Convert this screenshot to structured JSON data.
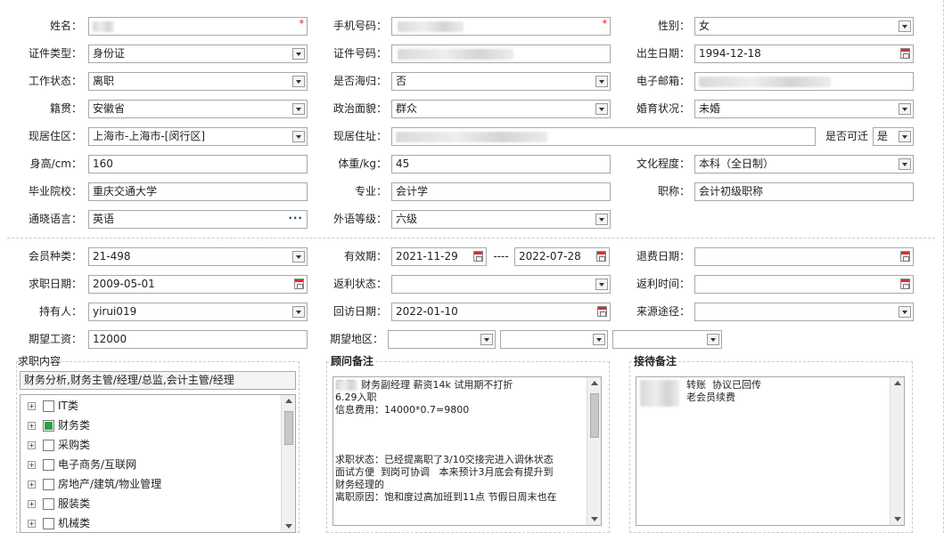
{
  "form": {
    "name_label": "姓名：",
    "name_value": "",
    "phone_label": "手机号码：",
    "phone_value": "",
    "gender_label": "性别：",
    "gender_value": "女",
    "id_type_label": "证件类型：",
    "id_type_value": "身份证",
    "id_no_label": "证件号码：",
    "id_no_value": "",
    "birth_label": "出生日期：",
    "birth_value": "1994-12-18",
    "work_status_label": "工作状态：",
    "work_status_value": "离职",
    "returnee_label": "是否海归：",
    "returnee_value": "否",
    "email_label": "电子邮箱：",
    "email_value": "",
    "native_label": "籍贯：",
    "native_value": "安徽省",
    "political_label": "政治面貌：",
    "political_value": "群众",
    "marital_label": "婚育状况：",
    "marital_value": "未婚",
    "residence_label": "现居住区：",
    "residence_value": "上海市-上海市-[闵行区]",
    "address_label": "现居住址：",
    "address_value": "",
    "relocate_label": "是否可迁",
    "relocate_value": "是",
    "height_label": "身高/cm：",
    "height_value": "160",
    "weight_label": "体重/kg：",
    "weight_value": "45",
    "education_label": "文化程度：",
    "education_value": "本科（全日制）",
    "school_label": "毕业院校：",
    "school_value": "重庆交通大学",
    "major_label": "专业：",
    "major_value": "会计学",
    "title_label": "职称：",
    "title_value": "会计初级职称",
    "language_label": "通晓语言：",
    "language_value": "英语",
    "lang_level_label": "外语等级：",
    "lang_level_value": "六级",
    "member_type_label": "会员种类：",
    "member_type_value": "21-498",
    "validity_label": "有效期：",
    "validity_start": "2021-11-29",
    "validity_sep": "----",
    "validity_end": "2022-07-28",
    "refund_date_label": "退费日期：",
    "refund_date_value": "",
    "job_date_label": "求职日期：",
    "job_date_value": "2009-05-01",
    "rebate_status_label": "返利状态：",
    "rebate_status_value": "",
    "rebate_time_label": "返利时间：",
    "rebate_time_value": "",
    "holder_label": "持有人：",
    "holder_value": "yirui019",
    "revisit_label": "回访日期：",
    "revisit_value": "2022-01-10",
    "source_label": "来源途径：",
    "source_value": "",
    "salary_label": "期望工资：",
    "salary_value": "12000",
    "region_label": "期望地区："
  },
  "job_panel": {
    "title": "求职内容",
    "summary": "财务分析,财务主管/经理/总监,会计主管/经理",
    "tree": [
      {
        "label": "IT类",
        "checked": false
      },
      {
        "label": "财务类",
        "checked": true
      },
      {
        "label": "采购类",
        "checked": false
      },
      {
        "label": "电子商务/互联网",
        "checked": false
      },
      {
        "label": "房地产/建筑/物业管理",
        "checked": false
      },
      {
        "label": "服装类",
        "checked": false
      },
      {
        "label": "机械类",
        "checked": false
      }
    ]
  },
  "advisor_panel": {
    "title": "顾问备注",
    "note": "录用  财务副经理 薪资14k 试用期不打折\n6.29入职\n信息费用：14000*0.7=9800\n\n\n\n求职状态：已经提离职了3/10交接完进入调休状态\n面试方便  到岗可协调   本来预计3月底会有提升到\n财务经理的\n离职原因：饱和度过高加班到11点 节假日周末也在"
  },
  "reception_panel": {
    "title": "接待备注",
    "note": "转账  协议已回传\n老会员续费"
  }
}
